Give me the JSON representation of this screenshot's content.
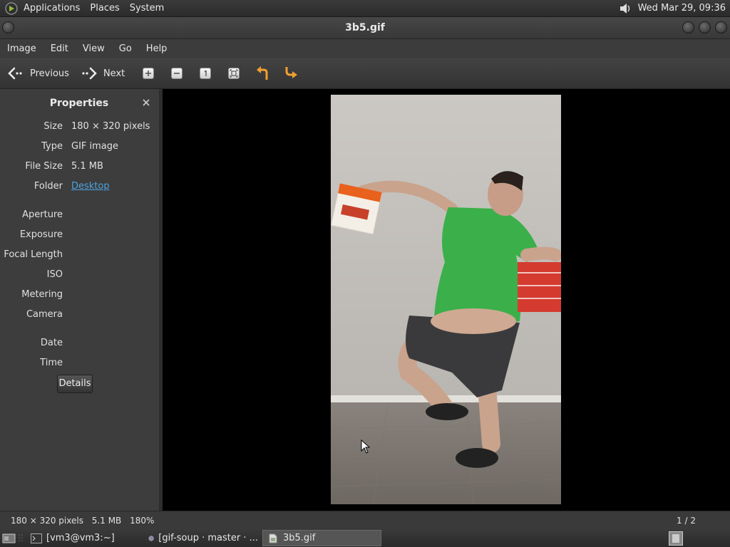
{
  "top_panel": {
    "menus": [
      "Applications",
      "Places",
      "System"
    ],
    "clock": "Wed Mar 29, 09:36"
  },
  "window": {
    "title": "3b5.gif"
  },
  "menubar": [
    "Image",
    "Edit",
    "View",
    "Go",
    "Help"
  ],
  "toolbar": {
    "previous_label": "Previous",
    "next_label": "Next",
    "icons": [
      "zoom-in-icon",
      "zoom-out-icon",
      "normal-size-icon",
      "best-fit-icon",
      "rotate-left-icon",
      "rotate-right-icon"
    ]
  },
  "sidebar": {
    "title": "Properties",
    "properties": [
      {
        "label": "Size",
        "value": "180 × 320 pixels"
      },
      {
        "label": "Type",
        "value": "GIF image"
      },
      {
        "label": "File Size",
        "value": "5.1 MB"
      },
      {
        "label": "Folder",
        "value": "Desktop"
      },
      {
        "label": "Aperture",
        "value": ""
      },
      {
        "label": "Exposure",
        "value": ""
      },
      {
        "label": "Focal Length",
        "value": ""
      },
      {
        "label": "ISO",
        "value": ""
      },
      {
        "label": "Metering",
        "value": ""
      },
      {
        "label": "Camera",
        "value": ""
      },
      {
        "label": "Date",
        "value": ""
      },
      {
        "label": "Time",
        "value": ""
      }
    ],
    "details_label": "Details"
  },
  "statusbar": {
    "dimensions": "180 × 320 pixels",
    "file_size": "5.1 MB",
    "zoom": "180%",
    "position": "1 / 2"
  },
  "taskbar": {
    "tasks": [
      {
        "label": "[vm3@vm3:~]"
      },
      {
        "label": "[gif-soup · master · ..."
      },
      {
        "label": "3b5.gif"
      }
    ]
  },
  "colors": {
    "accent_link": "#4aa3df",
    "rotate_arrow": "#f0a030",
    "shirt": "#3bb04a"
  }
}
